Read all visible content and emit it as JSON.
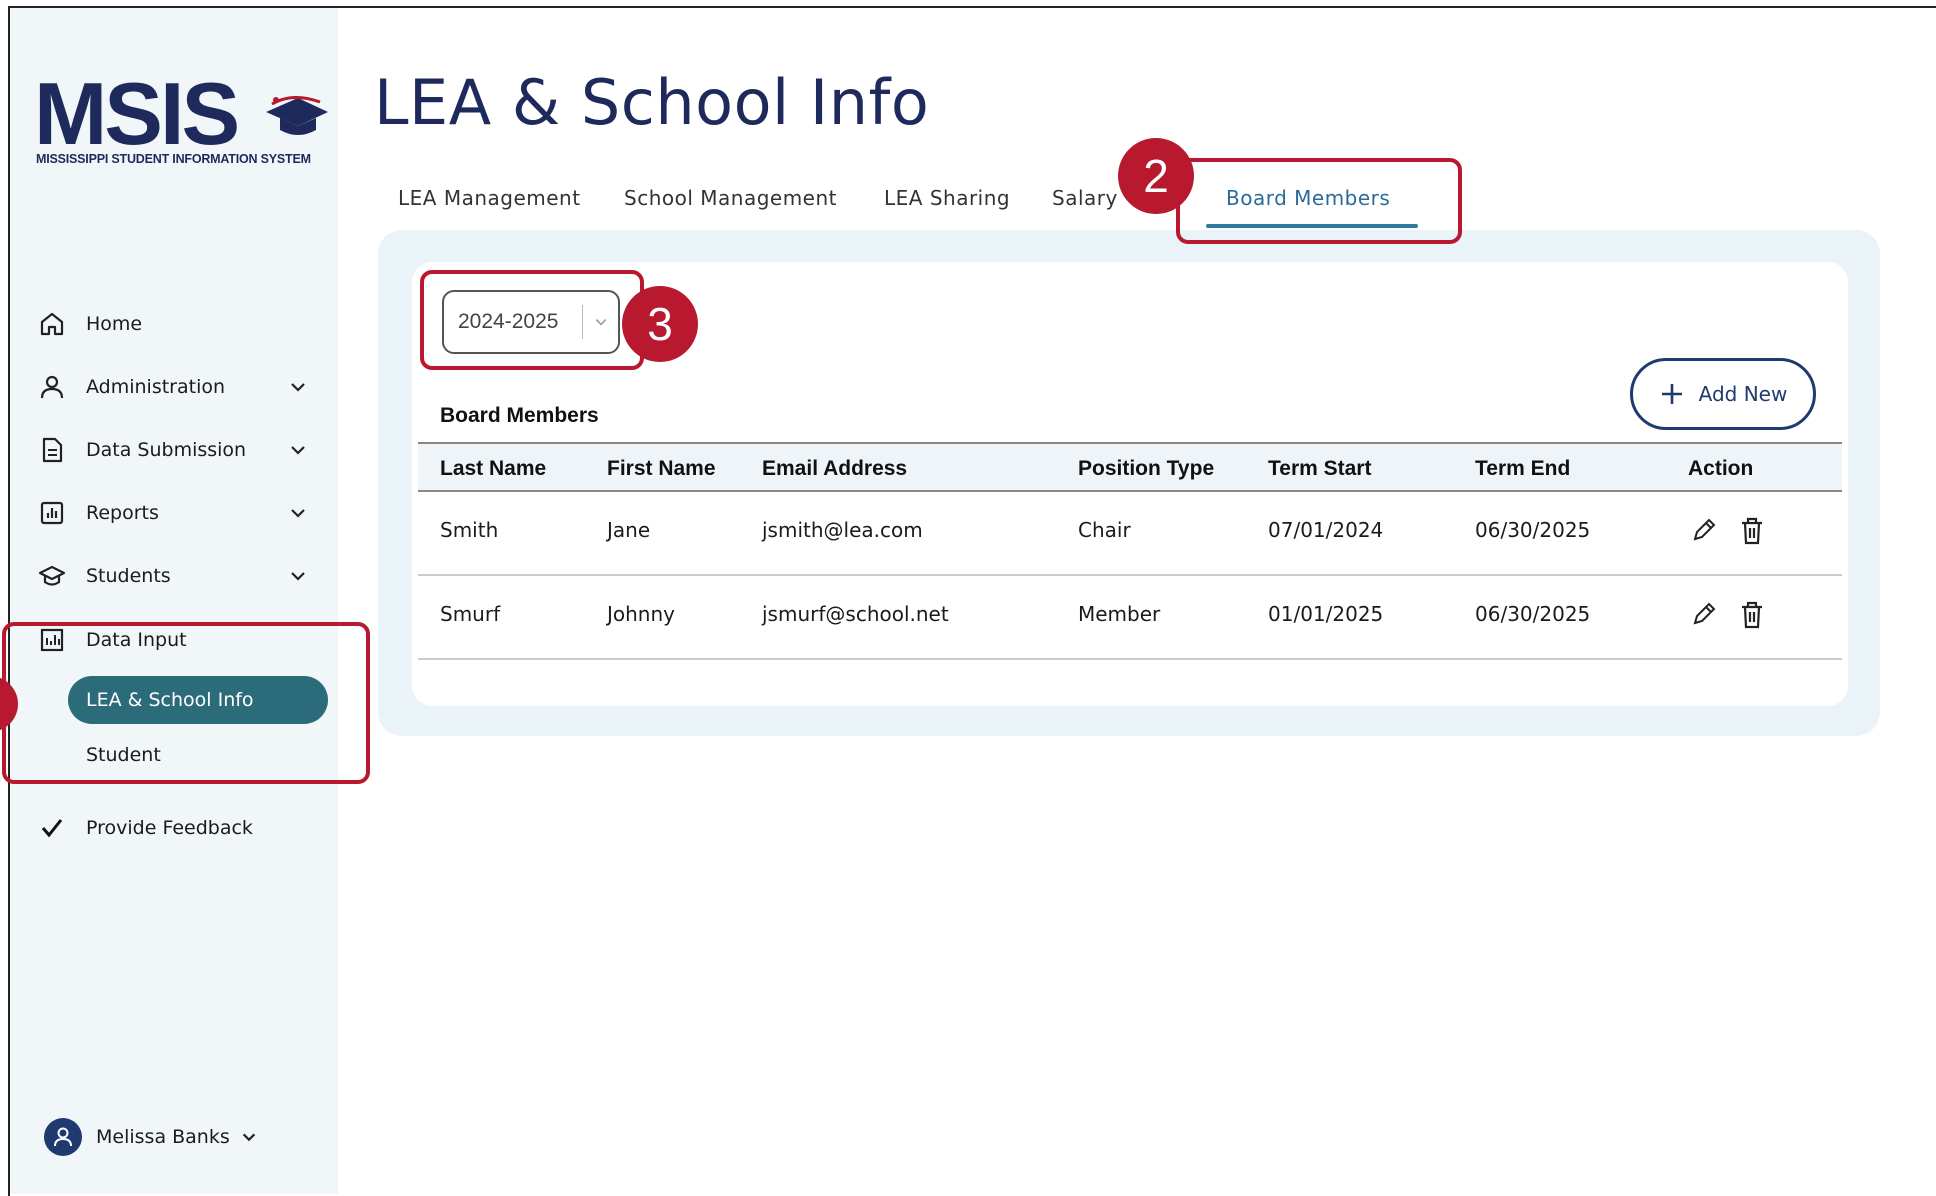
{
  "app": {
    "logo_text": "MSIS",
    "logo_subtitle": "MISSISSIPPI STUDENT INFORMATION SYSTEM"
  },
  "sidebar": {
    "items": [
      {
        "label": "Home",
        "icon": "home-icon"
      },
      {
        "label": "Administration",
        "icon": "user-icon",
        "expandable": true
      },
      {
        "label": "Data Submission",
        "icon": "document-icon",
        "expandable": true
      },
      {
        "label": "Reports",
        "icon": "bar-chart-icon",
        "expandable": true
      },
      {
        "label": "Students",
        "icon": "graduation-cap-icon",
        "expandable": true
      },
      {
        "label": "Data Input",
        "icon": "data-input-icon"
      },
      {
        "label": "Provide Feedback",
        "icon": "checkmark-icon"
      }
    ],
    "data_input_children": [
      {
        "label": "LEA & School Info",
        "active": true
      },
      {
        "label": "Student",
        "active": false
      }
    ],
    "user": {
      "name": "Melissa Banks"
    }
  },
  "page": {
    "title": "LEA & School Info"
  },
  "tabs": [
    {
      "label": "LEA Management"
    },
    {
      "label": "School Management"
    },
    {
      "label": "LEA Sharing"
    },
    {
      "label": "Salary"
    },
    {
      "label": "Board Members",
      "active": true
    }
  ],
  "filter": {
    "year_value": "2024-2025"
  },
  "section": {
    "title": "Board Members",
    "add_label": "Add New"
  },
  "table": {
    "columns": [
      "Last Name",
      "First Name",
      "Email Address",
      "Position Type",
      "Term Start",
      "Term End",
      "Action"
    ],
    "rows": [
      {
        "last": "Smith",
        "first": "Jane",
        "email": "jsmith@lea.com",
        "position": "Chair",
        "start": "07/01/2024",
        "end": "06/30/2025"
      },
      {
        "last": "Smurf",
        "first": "Johnny",
        "email": "jsmurf@school.net",
        "position": "Member",
        "start": "01/01/2025",
        "end": "06/30/2025"
      }
    ]
  },
  "annotations": {
    "step2": "2",
    "step3": "3"
  },
  "colors": {
    "brand_navy": "#1e2a5c",
    "active_teal": "#2b6b7a",
    "annotation_red": "#b8192f",
    "tab_active": "#2b6b9a"
  }
}
